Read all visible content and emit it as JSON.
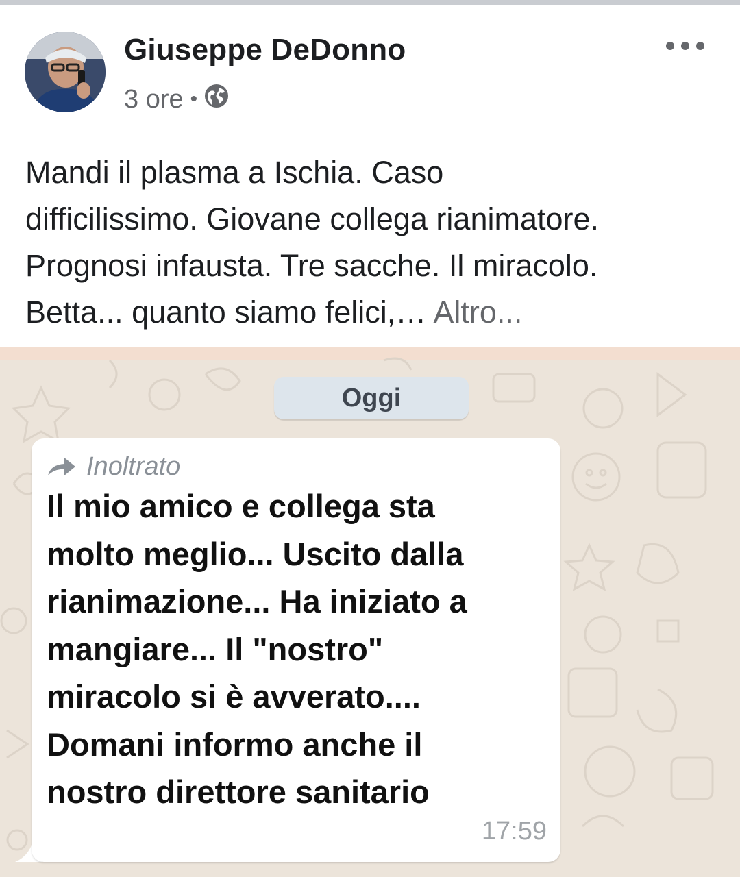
{
  "post": {
    "author": "Giuseppe DeDonno",
    "time_ago": "3 ore",
    "separator": "•",
    "audience_icon": "globe-icon",
    "menu_icon": "more-horizontal-icon",
    "lines": [
      "Mandi il plasma a Ischia. Caso",
      "difficilissimo. Giovane collega rianimatore.",
      "Prognosi infausta. Tre sacche. Il miracolo.",
      "Betta... quanto siamo felici,…"
    ],
    "see_more": "Altro..."
  },
  "chat": {
    "date_label": "Oggi",
    "forwarded_label": "Inoltrato",
    "forward_icon": "forward-arrow-icon",
    "lines": [
      "Il mio amico  e collega sta",
      "molto meglio... Uscito dalla",
      "rianimazione... Ha iniziato a",
      "mangiare... Il \"nostro\"",
      "miracolo  si è avverato....",
      "Domani informo anche  il",
      "nostro direttore sanitario"
    ],
    "time": "17:59"
  },
  "colors": {
    "chat_background": "#ece4da",
    "bubble": "#ffffff",
    "date_pill": "#dde5ec",
    "secondary_text": "#65676b"
  }
}
